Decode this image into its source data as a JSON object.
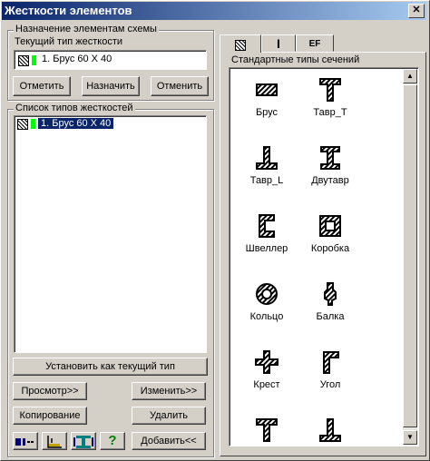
{
  "window": {
    "title": "Жесткости элементов",
    "close_glyph": "✕"
  },
  "assign_group": {
    "label": "Назначение элементам схемы",
    "current_type_label": "Текущий тип жесткости",
    "current_type_value": "1. Брус 60 X 40",
    "buttons": {
      "mark": "Отметить",
      "assign": "Назначить",
      "cancel": "Отменить"
    }
  },
  "types_group": {
    "label": "Список типов жесткостей",
    "items": [
      {
        "label": "1. Брус 60 X 40",
        "selected": true
      }
    ],
    "set_current_button": "Установить как текущий тип",
    "view_button": "Просмотр>>",
    "edit_button": "Изменить>>",
    "copy_button": "Копирование",
    "delete_button": "Удалить",
    "add_button": "Добавить<<",
    "icon_buttons": [
      "stiffness-list-icon",
      "axis-icon",
      "section-icon",
      "help-icon"
    ]
  },
  "tabs": [
    {
      "label": "▨",
      "icon": "hatched-section-icon",
      "active": true
    },
    {
      "label": "I",
      "icon": "i-beam-icon",
      "active": false
    },
    {
      "label": "EF",
      "icon": "ef-icon",
      "active": false
    }
  ],
  "sections_panel": {
    "label": "Стандартные типы сечений",
    "items": [
      {
        "label": "Брус",
        "icon": "bar-section-icon"
      },
      {
        "label": "Тавр_Т",
        "icon": "tee-section-icon"
      },
      {
        "label": "Тавр_L",
        "icon": "inverted-tee-section-icon"
      },
      {
        "label": "Двутавр",
        "icon": "i-section-icon"
      },
      {
        "label": "Швеллер",
        "icon": "channel-section-icon"
      },
      {
        "label": "Коробка",
        "icon": "box-section-icon"
      },
      {
        "label": "Кольцо",
        "icon": "ring-section-icon"
      },
      {
        "label": "Балка",
        "icon": "beam-section-icon"
      },
      {
        "label": "Крест",
        "icon": "cross-section-icon"
      },
      {
        "label": "Угол",
        "icon": "angle-section-icon"
      },
      {
        "label": "",
        "icon": "tee-section-icon"
      },
      {
        "label": "",
        "icon": "inverted-tee-section-icon"
      }
    ]
  },
  "colors": {
    "title_start": "#0a246a",
    "title_end": "#a6caf0",
    "selection": "#0a246a",
    "green_marker": "#00ff00"
  }
}
